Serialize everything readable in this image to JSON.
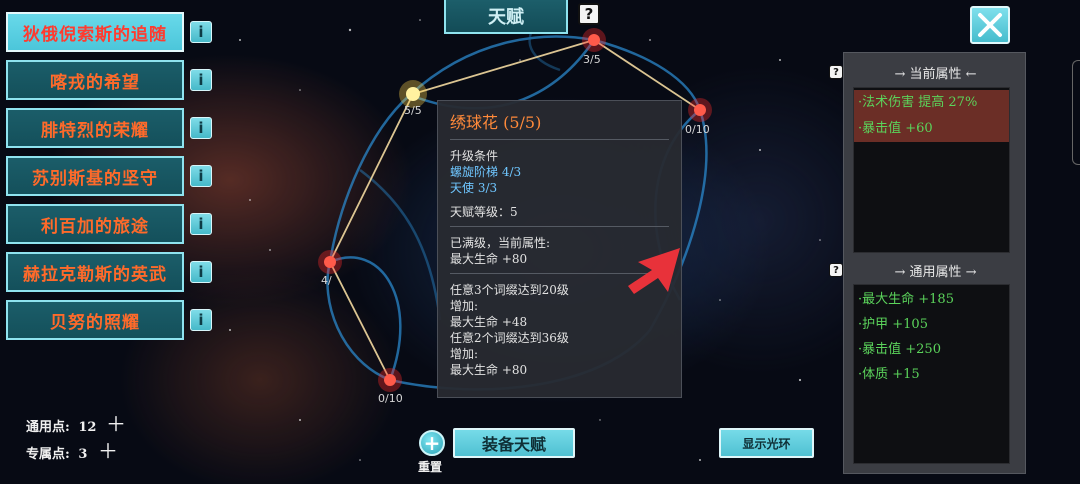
{
  "title": "天赋",
  "left_list": [
    {
      "label": "狄俄倪索斯的追随",
      "selected": true
    },
    {
      "label": "喀戎的希望",
      "selected": false
    },
    {
      "label": "腓特烈的荣耀",
      "selected": false
    },
    {
      "label": "苏别斯基的坚守",
      "selected": false
    },
    {
      "label": "利百加的旅途",
      "selected": false
    },
    {
      "label": "赫拉克勒斯的英武",
      "selected": false
    },
    {
      "label": "贝努的照耀",
      "selected": false
    }
  ],
  "info_icon_glyph": "i",
  "help_icon_glyph": "?",
  "nodes": [
    {
      "label": "3/5"
    },
    {
      "label": "5/5"
    },
    {
      "label": "0/10"
    },
    {
      "label": "4/"
    },
    {
      "label": "0/10"
    }
  ],
  "tooltip": {
    "title": "绣球花 (5/5)",
    "requirement_header": "升级条件",
    "requirements": [
      "螺旋阶梯 4/3",
      "天使 3/3"
    ],
    "level_line": "天赋等级：5",
    "maxed_header": "已满级，当前属性:",
    "maxed_value": "最大生命 +80",
    "bonus_lines": [
      "任意3个词缀达到20级",
      "增加:",
      "最大生命 +48",
      "任意2个词缀达到36级",
      "增加:",
      "最大生命 +80"
    ]
  },
  "right_panel": {
    "current_header": "当前属性",
    "current_attrs": [
      "·法术伤害 提高 27%",
      "·暴击值 +60"
    ],
    "general_header": "通用属性",
    "general_attrs": [
      "·最大生命 +185",
      "·护甲 +105",
      "·暴击值 +250",
      "·体质 +15"
    ]
  },
  "points": {
    "general_label": "通用点:",
    "general_value": "12",
    "exclusive_label": "专属点:",
    "exclusive_value": "3"
  },
  "buttons": {
    "reset_label": "重置",
    "equip_label": "装备天赋",
    "aura_label": "显示光环"
  },
  "colors": {
    "list_text": "#ff6a2a",
    "teal_button": "#4cc6da",
    "attr_green": "#5bd35b",
    "tooltip_title": "#ff8a3a",
    "requirement_blue": "#6fc6ff",
    "arrow_red": "#e8323a"
  }
}
